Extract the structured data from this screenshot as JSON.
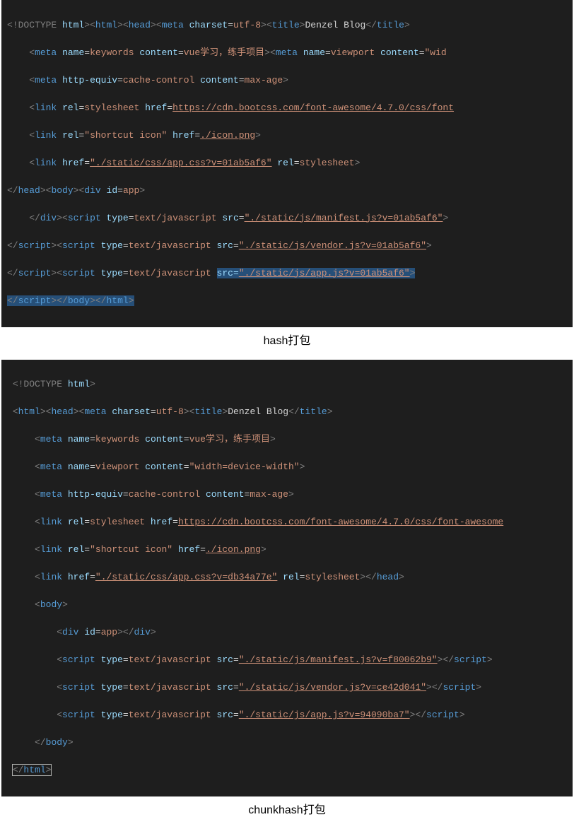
{
  "caption1": "hash打包",
  "caption2": "chunkhash打包",
  "block1": {
    "l1": {
      "open": "<!",
      "doctype": "DOCTYPE",
      "sp": " ",
      "html_kw": "html",
      "gt": ">",
      "ohtml": "<",
      "html": "html",
      "gt2": ">",
      "ohead": "<",
      "head": "head",
      "gt3": ">",
      "ometa": "<",
      "meta": "meta",
      "attr_charset": "charset",
      "val_charset": "utf-8",
      "gt4": ">",
      "otitle": "<",
      "title": "title",
      "gt5": ">",
      "title_text": "Denzel Blog",
      "ctitle": "</",
      "title2": "title",
      "gt6": ">"
    },
    "l2": {
      "ind": "    ",
      "o": "<",
      "meta": "meta",
      "name": "name",
      "vname": "keywords",
      "content": "content",
      "vcontent": "vue学习，练手项目",
      "gt": ">",
      "o2": "<",
      "meta2": "meta",
      "name2": "name",
      "vname2": "viewport",
      "content2": "content",
      "vcontent2": "\"wid"
    },
    "l3": {
      "ind": "    ",
      "o": "<",
      "meta": "meta",
      "httpeq": "http-equiv",
      "vhttpeq": "cache-control",
      "content": "content",
      "vcontent": "max-age",
      "gt": ">"
    },
    "l4": {
      "ind": "    ",
      "o": "<",
      "link": "link",
      "rel": "rel",
      "vrel": "stylesheet",
      "href": "href",
      "vhref": "https://cdn.bootcss.com/font-awesome/4.7.0/css/font"
    },
    "l5": {
      "ind": "    ",
      "o": "<",
      "link": "link",
      "rel": "rel",
      "vrel": "\"shortcut icon\"",
      "href": "href",
      "vhref": "./icon.png",
      "gt": ">"
    },
    "l6": {
      "ind": "    ",
      "o": "<",
      "link": "link",
      "href": "href",
      "vhref": "\"./static/css/app.css?v=01ab5af6\"",
      "rel": "rel",
      "vrel": "stylesheet",
      "gt": ">"
    },
    "l7": {
      "chead": "</",
      "head": "head",
      "gt": ">",
      "obody": "<",
      "body": "body",
      "gt2": ">",
      "odiv": "<",
      "div": "div",
      "id": "id",
      "vid": "app",
      "gt3": ">"
    },
    "l8": {
      "ind": "    ",
      "cdiv": "</",
      "div": "div",
      "gt": ">",
      "o": "<",
      "script": "script",
      "type": "type",
      "vtype": "text/javascript",
      "src": "src",
      "vsrc": "\"./static/js/manifest.js?v=01ab5af6\"",
      "gt2": ">"
    },
    "l9": {
      "csc": "</",
      "script": "script",
      "gt": ">",
      "o": "<",
      "script2": "script",
      "type": "type",
      "vtype": "text/javascript",
      "src": "src",
      "vsrc": "\"./static/js/vendor.js?v=01ab5af6\"",
      "gt2": ">"
    },
    "l10": {
      "csc": "</",
      "script": "script",
      "gt": ">",
      "o": "<",
      "script2": "script",
      "type": "type",
      "vtype": "text/javascript",
      "srcattr": "src=",
      "srcval": "\"./static/js/app.js?v=01ab5af6\"",
      "gt2": ">"
    },
    "l11": {
      "csc": "</",
      "script": "script",
      "gt": ">",
      "cbody": "</",
      "body": "body",
      "gt2": ">",
      "chtml": "</",
      "html": "html",
      "gt3": ">"
    }
  },
  "block2": {
    "l1": {
      "o": "<!",
      "doctype": "DOCTYPE",
      "sp": " ",
      "html_kw": "html",
      "gt": ">"
    },
    "l2": {
      "o": "<",
      "html": "html",
      "gt": ">",
      "o2": "<",
      "head": "head",
      "gt2": ">",
      "o3": "<",
      "meta": "meta",
      "charset": "charset",
      "vcharset": "utf-8",
      "gt3": ">",
      "o4": "<",
      "title": "title",
      "gt4": ">",
      "title_text": "Denzel Blog",
      "ct": "</",
      "title2": "title",
      "gt5": ">"
    },
    "l3": {
      "ind": "    ",
      "o": "<",
      "meta": "meta",
      "name": "name",
      "vname": "keywords",
      "content": "content",
      "vcontent": "vue学习，练手项目",
      "gt": ">"
    },
    "l4": {
      "ind": "    ",
      "o": "<",
      "meta": "meta",
      "name": "name",
      "vname": "viewport",
      "content": "content",
      "vcontent": "\"width=device-width\"",
      "gt": ">"
    },
    "l5": {
      "ind": "    ",
      "o": "<",
      "meta": "meta",
      "httpeq": "http-equiv",
      "vhttpeq": "cache-control",
      "content": "content",
      "vcontent": "max-age",
      "gt": ">"
    },
    "l6": {
      "ind": "    ",
      "o": "<",
      "link": "link",
      "rel": "rel",
      "vrel": "stylesheet",
      "href": "href",
      "vhref": "https://cdn.bootcss.com/font-awesome/4.7.0/css/font-awesome"
    },
    "l7": {
      "ind": "    ",
      "o": "<",
      "link": "link",
      "rel": "rel",
      "vrel": "\"shortcut icon\"",
      "href": "href",
      "vhref": "./icon.png",
      "gt": ">"
    },
    "l8": {
      "ind": "    ",
      "o": "<",
      "link": "link",
      "href": "href",
      "vhref": "\"./static/css/app.css?v=db34a77e\"",
      "rel": "rel",
      "vrel": "stylesheet",
      "gt": ">",
      "c": "</",
      "head": "head",
      "gt2": ">"
    },
    "l9": {
      "ind": "    ",
      "o": "<",
      "body": "body",
      "gt": ">"
    },
    "l10": {
      "ind": "        ",
      "o": "<",
      "div": "div",
      "id": "id",
      "vid": "app",
      "gt": ">",
      "c": "</",
      "div2": "div",
      "gt2": ">"
    },
    "l11": {
      "ind": "        ",
      "o": "<",
      "script": "script",
      "type": "type",
      "vtype": "text/javascript",
      "src": "src",
      "vsrc": "\"./static/js/manifest.js?v=f80062b9\"",
      "gt": ">",
      "c": "</",
      "script2": "script",
      "gt2": ">"
    },
    "l12": {
      "ind": "        ",
      "o": "<",
      "script": "script",
      "type": "type",
      "vtype": "text/javascript",
      "src": "src",
      "vsrc": "\"./static/js/vendor.js?v=ce42d041\"",
      "gt": ">",
      "c": "</",
      "script2": "script",
      "gt2": ">"
    },
    "l13": {
      "ind": "        ",
      "o": "<",
      "script": "script",
      "type": "type",
      "vtype": "text/javascript",
      "src": "src",
      "vsrc": "\"./static/js/app.js?v=94090ba7\"",
      "gt": ">",
      "c": "</",
      "script2": "script",
      "gt2": ">"
    },
    "l14": {
      "ind": "    ",
      "c": "</",
      "body": "body",
      "gt": ">"
    },
    "l15": {
      "c": "</",
      "html": "html",
      "gt": ">"
    }
  }
}
